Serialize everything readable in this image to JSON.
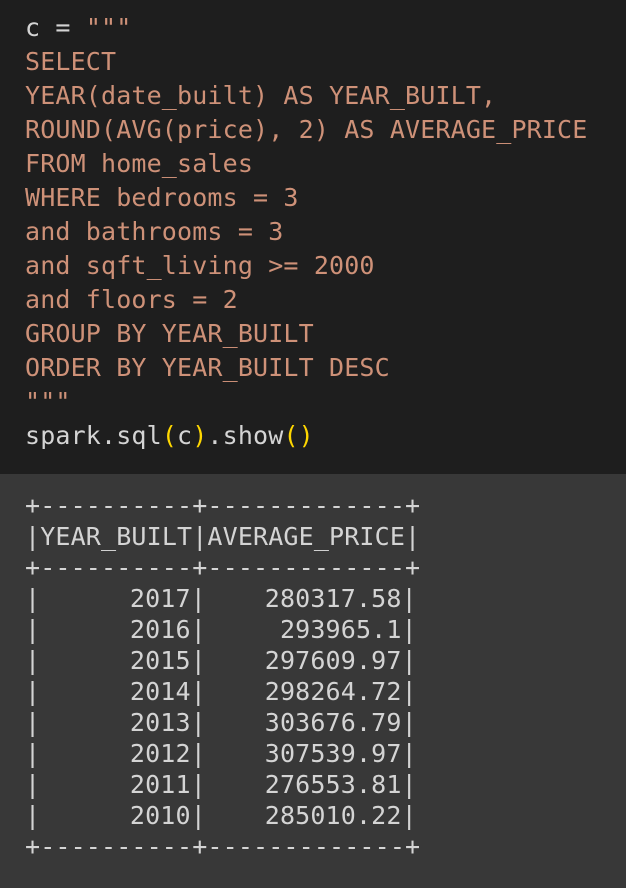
{
  "code": {
    "assign": "c = ",
    "open_quote": "\"\"\"",
    "sql_lines": [
      "SELECT",
      "YEAR(date_built) AS YEAR_BUILT,",
      "ROUND(AVG(price), 2) AS AVERAGE_PRICE",
      "FROM home_sales",
      "WHERE bedrooms = 3",
      "and bathrooms = 3",
      "and sqft_living >= 2000",
      "and floors = 2",
      "GROUP BY YEAR_BUILT",
      "ORDER BY YEAR_BUILT DESC"
    ],
    "close_quote": "\"\"\"",
    "call_prefix": "spark.sql",
    "lparen": "(",
    "arg": "c",
    "rparen": ")",
    "call_method": ".show",
    "empty_parens": "()"
  },
  "output": {
    "border": "+----------+-------------+",
    "columns": [
      "YEAR_BUILT",
      "AVERAGE_PRICE"
    ],
    "rows": [
      [
        "2017",
        "280317.58"
      ],
      [
        "2016",
        "293965.1"
      ],
      [
        "2015",
        "297609.97"
      ],
      [
        "2014",
        "298264.72"
      ],
      [
        "2013",
        "303676.79"
      ],
      [
        "2012",
        "307539.97"
      ],
      [
        "2011",
        "276553.81"
      ],
      [
        "2010",
        "285010.22"
      ]
    ]
  }
}
